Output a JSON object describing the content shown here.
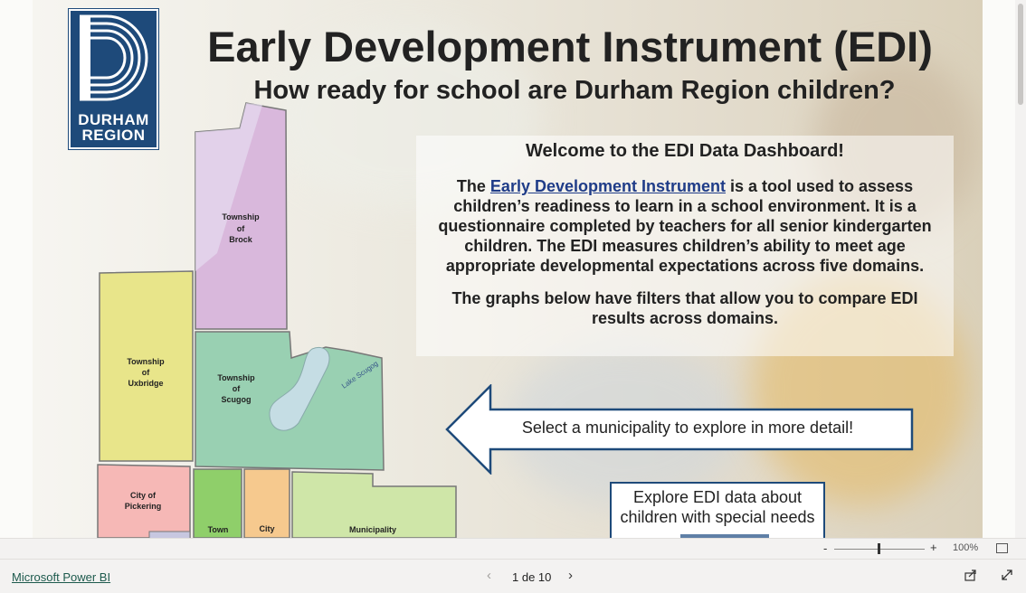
{
  "report": {
    "logo_text": [
      "DURHAM",
      "REGION"
    ],
    "title": "Early Development Instrument (EDI)",
    "subtitle": "How ready for  school are Durham Region children?",
    "welcome": {
      "heading": "Welcome to the EDI Data Dashboard!",
      "p1_prefix": "The ",
      "p1_link": "Early Development Instrument",
      "p1_suffix": " is a tool used to assess children’s readiness to learn in a school environment. It is a questionnaire completed by teachers for all senior kindergarten children. The EDI measures children’s ability to meet age appropriate developmental expectations across five domains.",
      "p2": "The graphs below have filters that allow you to compare EDI results across domains."
    },
    "arrow_text": "Select a municipality to explore in more detail!",
    "special_needs_text": "Explore EDI data about children with special needs",
    "map": {
      "brock": [
        "Township",
        "of",
        "Brock"
      ],
      "uxbridge": [
        "Township",
        "of",
        "Uxbridge"
      ],
      "scugog": [
        "Township",
        "of",
        "Scugog"
      ],
      "lake": "Lake Scugog",
      "pickering": [
        "City of",
        "Pickering"
      ],
      "town": "Town",
      "city": "City",
      "municipality": "Municipality"
    }
  },
  "zoom": {
    "minus": "-",
    "plus": "+",
    "value": "100%",
    "level": 0.5
  },
  "footer": {
    "brand": "Microsoft Power BI",
    "page_indicator": "1 de 10",
    "prev": "‹",
    "next": "›"
  },
  "colors": {
    "brand_navy": "#1e4a7a",
    "brock": "#d9b8dc",
    "uxbridge": "#e8e58a",
    "scugog": "#99d0b2",
    "pickering": "#f6b8b6",
    "ajax": "#8fcf6a",
    "whitby": "#f6c98e",
    "clarington": "#cfe6a8"
  }
}
